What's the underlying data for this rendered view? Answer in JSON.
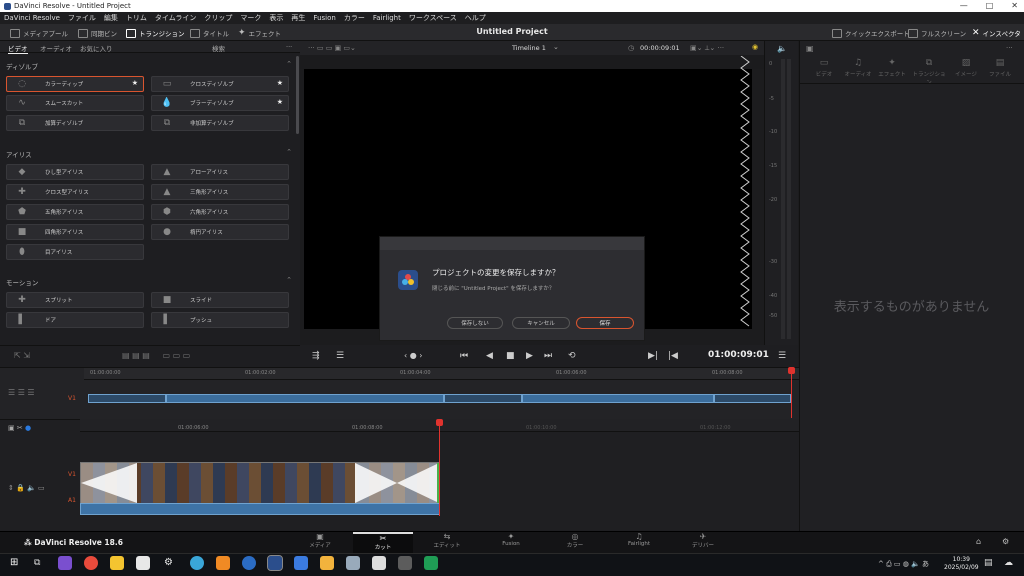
{
  "window": {
    "title": "DaVinci Resolve - Untitled Project",
    "controls": [
      "—",
      "□",
      "✕"
    ]
  },
  "menu": [
    "DaVinci Resolve",
    "ファイル",
    "編集",
    "トリム",
    "タイムライン",
    "クリップ",
    "マーク",
    "表示",
    "再生",
    "Fusion",
    "カラー",
    "Fairlight",
    "ワークスペース",
    "ヘルプ"
  ],
  "toolbar": {
    "media_pool": "メディアプール",
    "sync_bin": "同期ビン",
    "transitions": "トランジション",
    "titles": "タイトル",
    "effects": "エフェクト",
    "quick_export": "クイックエクスポート",
    "fullscreen": "フルスクリーン",
    "inspector": "インスペクタ"
  },
  "project_title": "Untitled Project",
  "left_tabs": {
    "video": "ビデオ",
    "audio": "オーディオ",
    "favorites": "お気に入り",
    "search": "検索"
  },
  "sections": {
    "dissolve": {
      "title": "ディゾルブ",
      "items": [
        {
          "label": "カラーディップ",
          "icon": "dip",
          "star": "★",
          "selected": true
        },
        {
          "label": "クロスディゾルブ",
          "icon": "cross",
          "star": "★"
        },
        {
          "label": "スムースカット",
          "icon": "wave",
          "star": ""
        },
        {
          "label": "ブラーディゾルブ",
          "icon": "drop",
          "star": "★"
        },
        {
          "label": "加算ディゾルブ",
          "icon": "add",
          "star": ""
        },
        {
          "label": "非加算ディゾルブ",
          "icon": "nonadd",
          "star": ""
        }
      ]
    },
    "iris": {
      "title": "アイリス",
      "items": [
        {
          "label": "ひし型アイリス",
          "icon": "◆"
        },
        {
          "label": "アローアイリス",
          "icon": "▲"
        },
        {
          "label": "クロス型アイリス",
          "icon": "✚"
        },
        {
          "label": "三角形アイリス",
          "icon": "▲"
        },
        {
          "label": "五角形アイリス",
          "icon": "⬟"
        },
        {
          "label": "六角形アイリス",
          "icon": "⬢"
        },
        {
          "label": "四角形アイリス",
          "icon": "■"
        },
        {
          "label": "楕円アイリス",
          "icon": "●"
        },
        {
          "label": "目アイリス",
          "icon": "⬮"
        }
      ]
    },
    "motion": {
      "title": "モーション",
      "items": [
        {
          "label": "スプリット",
          "icon": "✚"
        },
        {
          "label": "スライド",
          "icon": "■"
        },
        {
          "label": "ドア",
          "icon": "▌"
        },
        {
          "label": "プッシュ",
          "icon": "▌"
        }
      ]
    }
  },
  "viewer": {
    "timeline_name": "Timeline 1",
    "timecode_top": "00:00:09:01",
    "timecode_main": "01:00:09:01"
  },
  "meter_labels": [
    "0",
    "-5",
    "-10",
    "-15",
    "-20",
    "-30",
    "-40",
    "-50"
  ],
  "inspector": {
    "tabs": [
      "ビデオ",
      "オーディオ",
      "エフェクト",
      "トランジション",
      "イメージ",
      "ファイル"
    ],
    "empty_message": "表示するものがありません"
  },
  "dialog": {
    "title": "プロジェクトの変更を保存しますか？",
    "message": "閉じる前に \"Untitled Project\" を保存しますか？",
    "btn_dont_save": "保存しない",
    "btn_cancel": "キャンセル",
    "btn_save": "保存"
  },
  "upper_ruler": [
    "01:00:00:00",
    "01:00:02:00",
    "01:00:04:00",
    "01:00:06:00",
    "01:00:08:00"
  ],
  "lower_ruler": [
    "01:00:06:00",
    "01:00:08:00",
    "01:00:10:00",
    "01:00:12:00"
  ],
  "tracks": {
    "v1": "V1",
    "a1": "A1",
    "v1_upper": "V1"
  },
  "app_brand": "DaVinci Resolve 18.6",
  "pages": [
    {
      "label": "メディア",
      "icon": "▣"
    },
    {
      "label": "カット",
      "icon": "✂",
      "active": true
    },
    {
      "label": "エディット",
      "icon": "⇆"
    },
    {
      "label": "Fusion",
      "icon": "✦"
    },
    {
      "label": "カラー",
      "icon": "◎"
    },
    {
      "label": "Fairlight",
      "icon": "♫"
    },
    {
      "label": "デリバー",
      "icon": "✈"
    }
  ],
  "clock": {
    "time": "10:39",
    "date": "2025/02/09"
  },
  "colors": {
    "accent": "#d9552f",
    "playhead": "#e0332e",
    "clip_blue": "#3e73a6"
  }
}
